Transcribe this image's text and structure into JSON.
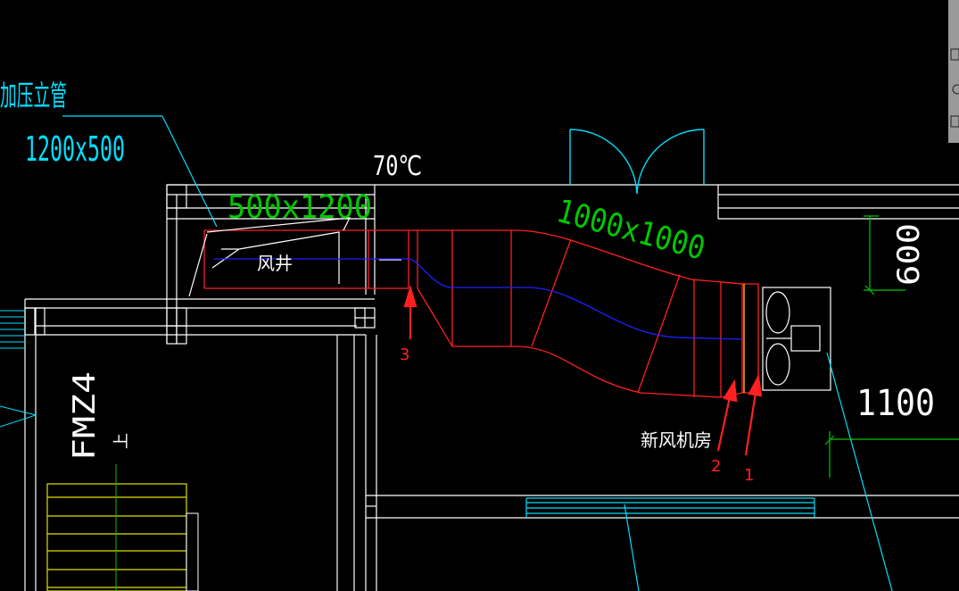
{
  "drawing": {
    "background": "#000000",
    "colors": {
      "wall": "#ffffff",
      "duct": "#ff2020",
      "centerline": "#2020ff",
      "dimension": "#00c800",
      "leader": "#00e0ff",
      "stair": "#e0e000",
      "arrow": "#ff2020",
      "damper": "#ffff00"
    }
  },
  "labels": {
    "riser_title": "加压立管",
    "riser_size": "1200x500",
    "temperature": "70℃",
    "shaft_duct_size": "500x1200",
    "shaft_label": "风井",
    "main_duct_size": "1000x1000",
    "dimension_600": "600",
    "dimension_1100": "1100",
    "room_label": "新风机房",
    "door_code": "FMZ4",
    "stair_up": "上"
  },
  "markers": [
    {
      "number": "1"
    },
    {
      "number": "2"
    },
    {
      "number": "3"
    }
  ]
}
